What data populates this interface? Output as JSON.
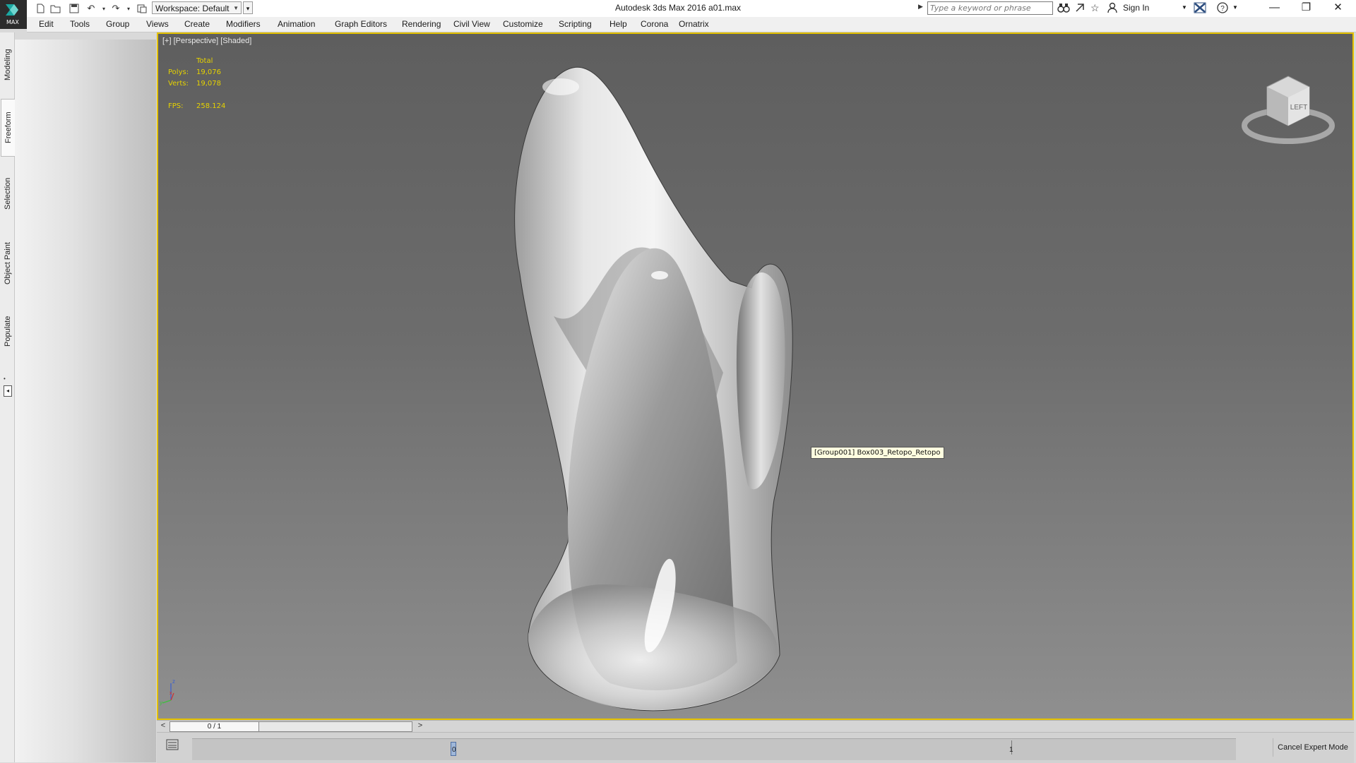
{
  "title_bar": {
    "app_title": "Autodesk 3ds Max 2016     a01.max",
    "app_button_label": "MAX",
    "workspace_label": "Workspace: Default",
    "search_placeholder": "Type a keyword or phrase",
    "sign_in_label": "Sign In",
    "minimize": "—",
    "restore": "❐",
    "close": "✕"
  },
  "menu": [
    "Edit",
    "Tools",
    "Group",
    "Views",
    "Create",
    "Modifiers",
    "Animation",
    "Graph Editors",
    "Rendering",
    "Civil View",
    "Customize",
    "Scripting",
    "Help",
    "Corona",
    "Ornatrix"
  ],
  "left_tabs": [
    "Modeling",
    "Freeform",
    "Selection",
    "Object Paint",
    "Populate"
  ],
  "active_left_tab": "Freeform",
  "viewport": {
    "label": "[+] [Perspective] [Shaded]",
    "stats": {
      "header": "Total",
      "polys_label": "Polys:",
      "polys_value": "19,076",
      "verts_label": "Verts:",
      "verts_value": "19,078",
      "fps_label": "FPS:",
      "fps_value": "258.124"
    },
    "tooltip": "[Group001] Box003_Retopo_Retopo",
    "viewcube_label": "LEFT",
    "axis_labels": {
      "x": "x",
      "y": "y",
      "z": "z"
    }
  },
  "timeline": {
    "slider_label": "0 / 1",
    "prev_label": "<",
    "next_label": ">",
    "start_frame": "0",
    "end_frame": "1"
  },
  "cancel_expert_label": "Cancel Expert Mode",
  "colors": {
    "viewport_border": "#e5c200",
    "stats_text": "#e6d200",
    "app_button_bg": "#2c2c2c"
  }
}
